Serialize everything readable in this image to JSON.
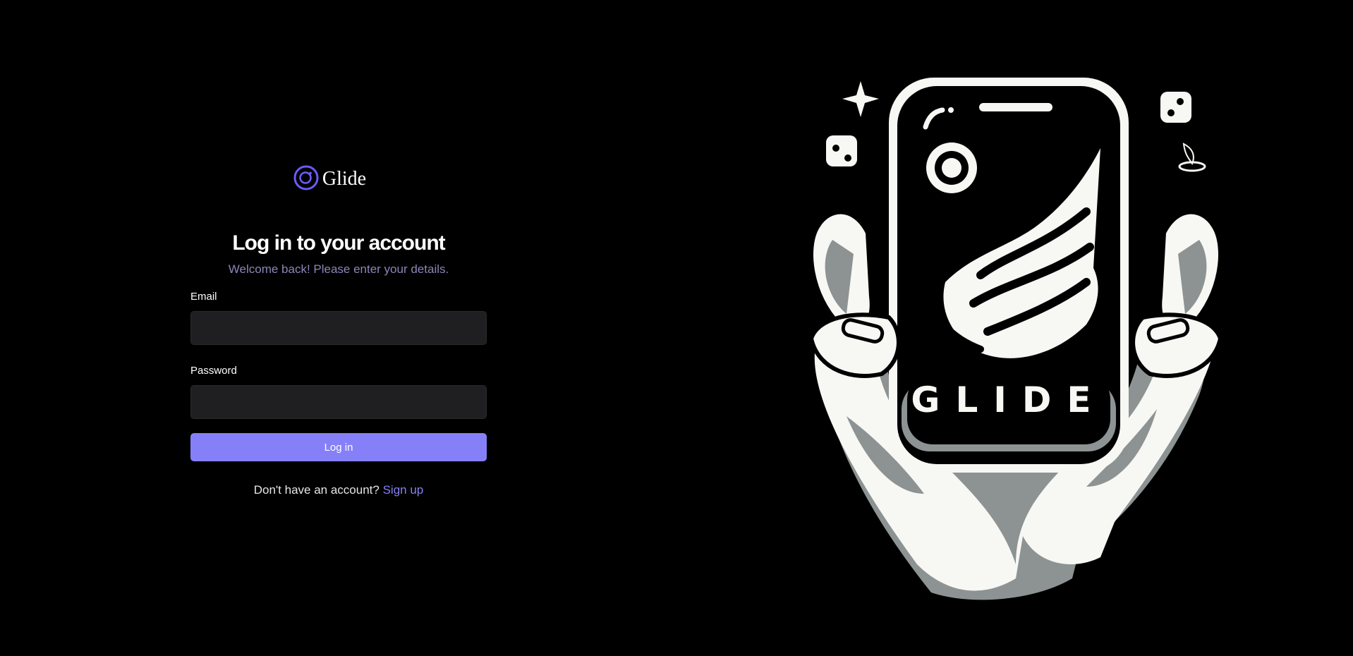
{
  "brand": {
    "name": "Glide",
    "icon": "glide-ring-icon",
    "accent_color": "#6b5cf5"
  },
  "login": {
    "title": "Log in to your account",
    "subtitle": "Welcome back! Please enter your details.",
    "email_label": "Email",
    "email_value": "",
    "password_label": "Password",
    "password_value": "",
    "submit_label": "Log in",
    "signup_prompt": "Don't have an account?",
    "signup_link": "Sign up",
    "button_color": "#8680f8",
    "subtitle_color": "#8a86b8"
  },
  "illustration": {
    "phone_wordmark": "GLIDE",
    "icons": [
      "sparkle-icon",
      "dice-icon",
      "dice-icon",
      "flame-icon"
    ]
  }
}
